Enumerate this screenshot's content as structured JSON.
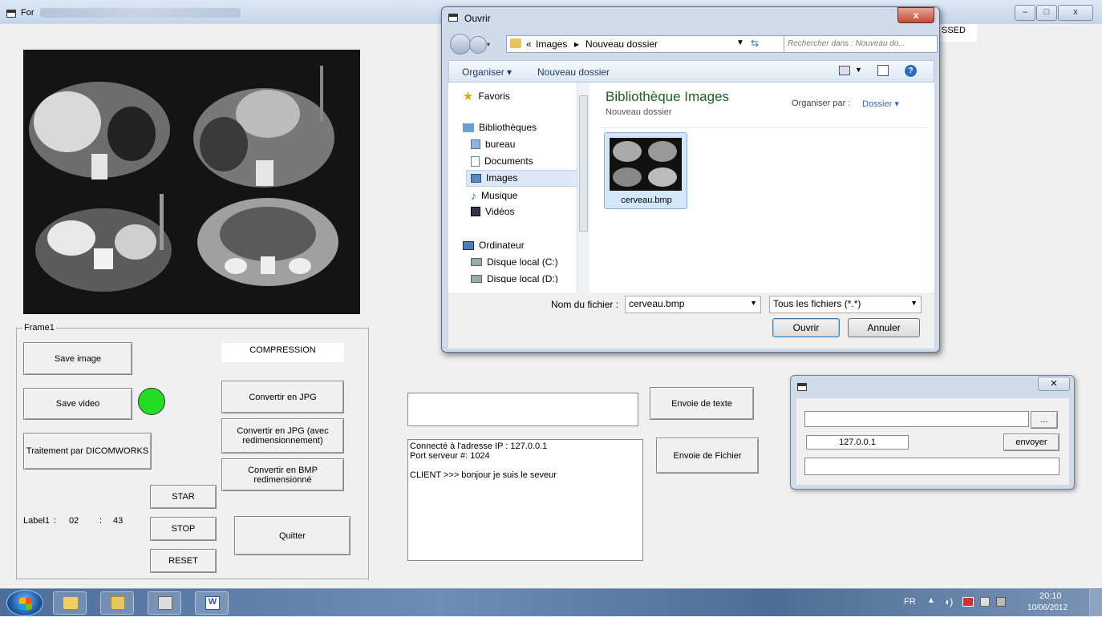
{
  "main": {
    "title": "For",
    "partial_label": "SSED",
    "frame_label": "Frame1",
    "save_image": "Save image",
    "save_video": "Save video",
    "traitement": "Traitement par DICOMWORKS",
    "compression": "COMPRESSION",
    "convert_jpg": "Convertir en JPG",
    "convert_jpg_resize": "Convertir en JPG (avec redimensionnement)",
    "convert_bmp": "Convertir en BMP redimensionné",
    "star": "STAR",
    "stop": "STOP",
    "reset": "RESET",
    "quit": "Quitter",
    "timer_label": "Label1",
    "timer_sep1": ":",
    "timer_min": "02",
    "timer_sep2": ":",
    "timer_sec": "43",
    "envoie_texte": "Envoie de texte",
    "envoie_fichier": "Envoie de Fichier",
    "log_lines": [
      "Connecté à l'adresse IP : 127.0.0.1",
      "Port serveur #: 1024",
      "",
      "CLIENT >>> bonjour je suis le seveur"
    ],
    "status_color": "#22dd22"
  },
  "dialog": {
    "title": "Ouvrir",
    "breadcrumb_prefix": "«",
    "breadcrumb_1": "Images",
    "breadcrumb_2": "Nouveau dossier",
    "search_placeholder": "Rechercher dans : Nouveau do...",
    "organiser": "Organiser ▾",
    "nouveau_dossier": "Nouveau dossier",
    "nav": {
      "favoris": "Favoris",
      "bibliotheques": "Bibliothèques",
      "bureau": "bureau",
      "documents": "Documents",
      "images": "Images",
      "musique": "Musique",
      "videos": "Vidéos",
      "ordinateur": "Ordinateur",
      "disque_c": "Disque local (C:)",
      "disque_d": "Disque local (D:)"
    },
    "library_title": "Bibliothèque Images",
    "library_sub": "Nouveau dossier",
    "arrange_label": "Organiser par :",
    "arrange_value": "Dossier ▾",
    "file_name": "cerveau.bmp",
    "filename_label": "Nom du fichier :",
    "filename_value": "cerveau.bmp",
    "filter": "Tous les fichiers (*.*)",
    "open": "Ouvrir",
    "cancel": "Annuler",
    "close": "x"
  },
  "smallwin": {
    "browse": "...",
    "ip": "127.0.0.1",
    "send": "envoyer",
    "close": "✕"
  },
  "taskbar": {
    "lang": "FR",
    "time": "20:10",
    "date": "10/06/2012"
  }
}
